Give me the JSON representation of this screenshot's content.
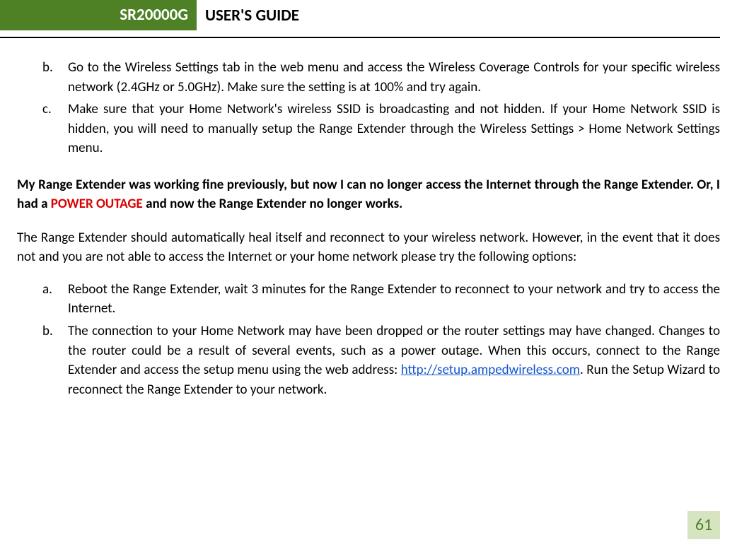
{
  "header": {
    "model": "SR20000G",
    "title": "USER'S GUIDE"
  },
  "list1": {
    "items": [
      {
        "marker": "b.",
        "text": "Go to the Wireless Settings tab in the web menu and access the Wireless Coverage Controls for your specific wireless network (2.4GHz or 5.0GHz). Make sure the setting is at 100% and try again."
      },
      {
        "marker": "c.",
        "text": "Make sure that your Home Network's wireless SSID is broadcasting and not hidden. If your Home Network SSID is hidden, you will need to manually setup the Range Extender through the Wireless Settings > Home Network Settings menu."
      }
    ]
  },
  "heading": {
    "before_red": "My Range Extender was working fine previously, but now I can no longer access the Internet through the Range Extender. Or, I had a ",
    "red": "POWER OUTAGE",
    "after_red": " and now the Range Extender no longer works."
  },
  "para1": "The Range Extender should automatically heal itself and reconnect to your wireless network. However, in the event that it does not and you are not able to access the Internet or your home network please try the following options:",
  "list2": {
    "items": [
      {
        "marker": "a.",
        "text": "Reboot the Range Extender, wait 3 minutes for the Range Extender to reconnect to your network and try to access the Internet."
      },
      {
        "marker": "b.",
        "before_link": "The connection to your Home Network may have been dropped or the router settings may have changed. Changes to the router could be a result of several events, such as a power outage. When this occurs, connect to the Range Extender and access the setup menu using the web address: ",
        "link_text": "http://setup.ampedwireless.com",
        "link_href": "http://setup.ampedwireless.com",
        "after_link": ". Run the Setup Wizard to reconnect the Range Extender to your network."
      }
    ]
  },
  "page_number": "61"
}
